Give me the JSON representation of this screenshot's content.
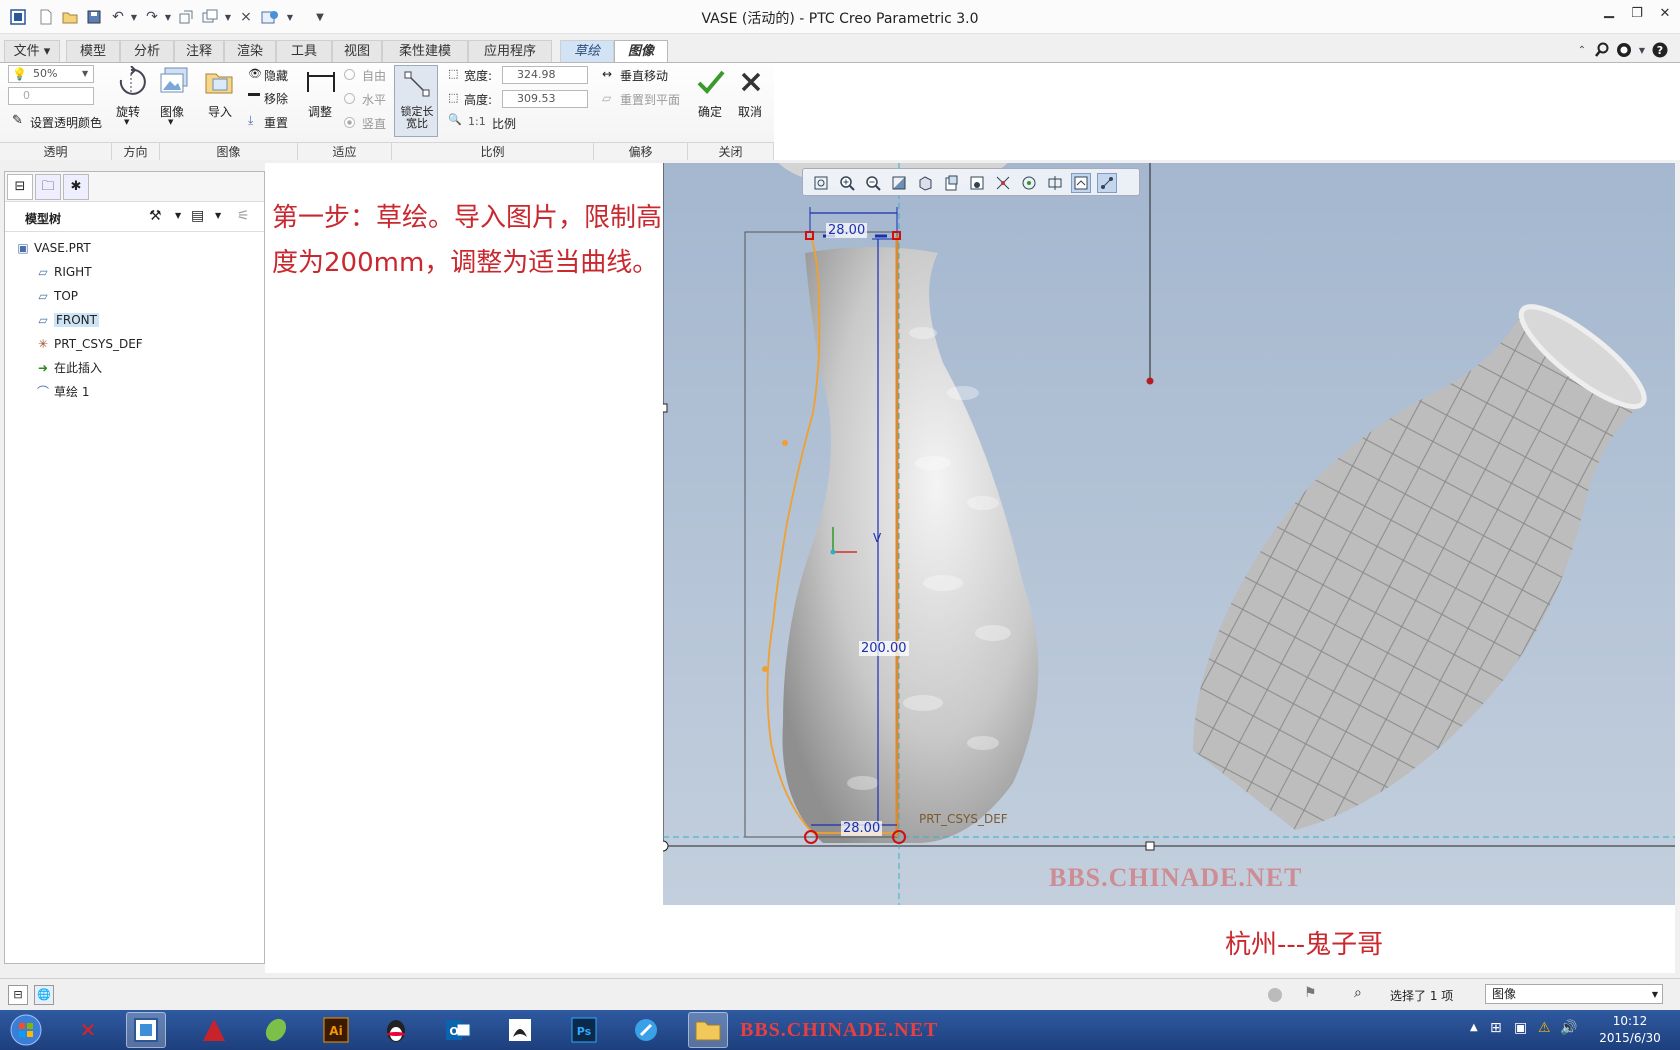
{
  "window": {
    "title": "VASE (活动的) - PTC Creo Parametric 3.0"
  },
  "menu": {
    "tabs": [
      {
        "label": "文件"
      },
      {
        "label": "模型"
      },
      {
        "label": "分析"
      },
      {
        "label": "注释"
      },
      {
        "label": "渲染"
      },
      {
        "label": "工具"
      },
      {
        "label": "视图"
      },
      {
        "label": "柔性建模"
      },
      {
        "label": "应用程序"
      },
      {
        "label": "草绘"
      },
      {
        "label": "图像"
      }
    ]
  },
  "ribbon": {
    "transparency": {
      "value": "50%",
      "secondary_value": "0",
      "set_color_label": "设置透明颜色",
      "group_label": "透明"
    },
    "direction": {
      "rotate_label": "旋转",
      "group_label": "方向"
    },
    "image": {
      "image_label": "图像",
      "import_label": "导入",
      "hide_label": "隐藏",
      "remove_label": "移除",
      "reset_label": "重置",
      "group_label": "图像"
    },
    "fit": {
      "adjust_label": "调整",
      "free_label": "自由",
      "horizontal_label": "水平",
      "vertical_label": "竖直",
      "group_label": "适应"
    },
    "scale": {
      "lock_ratio_label": "锁定长宽比",
      "width_label": "宽度:",
      "width_value": "324.98",
      "height_label": "高度:",
      "height_value": "309.53",
      "ratio_prefix": "1:1",
      "ratio_label": "比例",
      "group_label": "比例"
    },
    "offset": {
      "vertical_move_label": "垂直移动",
      "reset_to_plane_label": "重置到平面",
      "group_label": "偏移"
    },
    "close": {
      "ok_label": "确定",
      "cancel_label": "取消",
      "group_label": "关闭"
    }
  },
  "model_tree": {
    "header": "模型树",
    "items": [
      {
        "label": "VASE.PRT",
        "icon": "part-icon"
      },
      {
        "label": "RIGHT",
        "icon": "datum-plane-icon"
      },
      {
        "label": "TOP",
        "icon": "datum-plane-icon"
      },
      {
        "label": "FRONT",
        "icon": "datum-plane-icon"
      },
      {
        "label": "PRT_CSYS_DEF",
        "icon": "csys-icon"
      },
      {
        "label": "在此插入",
        "icon": "insert-arrow-icon"
      },
      {
        "label": "草绘 1",
        "icon": "sketch-icon"
      }
    ]
  },
  "canvas": {
    "instruction": "第一步：草绘。导入图片，限制高度为200mm，调整为适当曲线。",
    "dim_top": "28.00",
    "dim_bottom": "28.00",
    "dim_height": "200.00",
    "dim_v": "V",
    "csys_label": "PRT_CSYS_DEF",
    "watermark": "BBS.CHINADE.NET",
    "author": "杭州---鬼子哥"
  },
  "status": {
    "selection_text": "选择了 1 项",
    "filter_value": "图像"
  },
  "taskbar": {
    "watermark": "BBS.CHINADE.NET",
    "time": "10:12",
    "date": "2015/6/30"
  },
  "colors": {
    "accent_red": "#c8282e",
    "sketch_tab": "#d2e3f5",
    "canvas_bg": "#a4b7cf",
    "dimension_blue": "#1a2fb0",
    "sketch_orange": "#f0a030"
  }
}
